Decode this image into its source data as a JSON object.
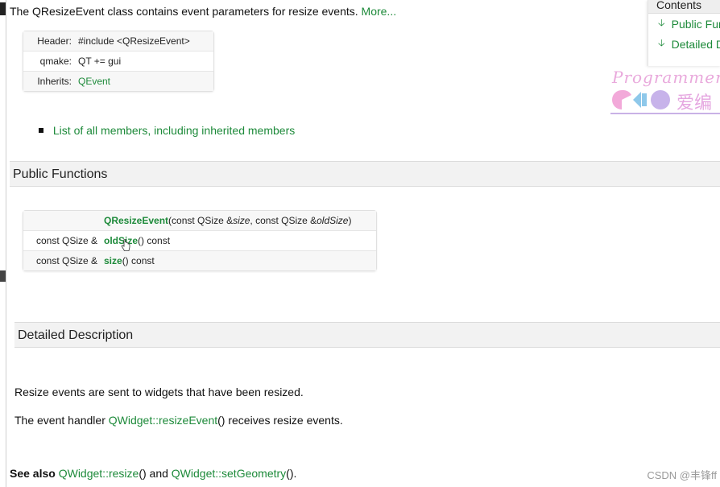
{
  "intro": {
    "text": "The QResizeEvent class contains event parameters for resize events.",
    "more_link": "More..."
  },
  "info_box": {
    "rows": [
      {
        "key": "Header:",
        "value": "#include <QResizeEvent>"
      },
      {
        "key": "qmake:",
        "value": "QT += gui"
      },
      {
        "key": "Inherits:",
        "value": "QEvent"
      }
    ]
  },
  "members_link": "List of all members, including inherited members",
  "public_functions": {
    "title": "Public Functions",
    "rows": [
      {
        "ret": "",
        "name": "QResizeEvent",
        "pre": "(const QSize &",
        "p1": "size",
        "mid": ", const QSize &",
        "p2": "oldSize",
        "post": ")"
      },
      {
        "ret": "const QSize &",
        "name": "oldSize",
        "rest": "() const"
      },
      {
        "ret": "const QSize &",
        "name": "size",
        "rest": "() const"
      }
    ]
  },
  "detailed": {
    "title": "Detailed Description",
    "para1": "Resize events are sent to widgets that have been resized.",
    "para2_pre": "The event handler ",
    "para2_link": "QWidget::resizeEvent",
    "para2_post": "() receives resize events."
  },
  "see_also": {
    "label": "See also",
    "link1": "QWidget::resize",
    "between": "() and ",
    "link2": "QWidget::setGeometry",
    "end": "()."
  },
  "toc": {
    "heading": "Contents",
    "items": [
      "Public Functions",
      "Detailed Description"
    ]
  },
  "watermark": {
    "text": "Programmer Su",
    "cn": "爱编"
  },
  "credit": "CSDN @丰锋ff",
  "colors": {
    "link": "#1d8a3a",
    "section_bg": "#f2f2f2"
  }
}
